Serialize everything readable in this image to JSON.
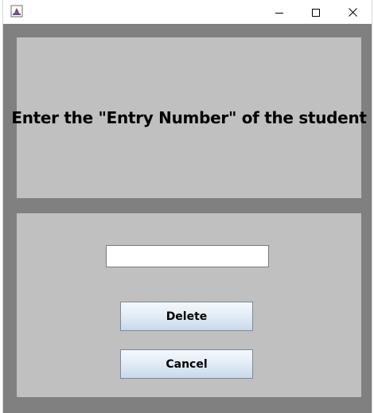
{
  "window": {
    "title": "",
    "controls": {
      "minimize_icon": "minimize-icon",
      "maximize_icon": "maximize-icon",
      "close_icon": "close-icon"
    }
  },
  "dialog": {
    "prompt": "Enter the \"Entry Number\" of the student",
    "entry_input": {
      "value": "",
      "placeholder": ""
    },
    "delete_label": "Delete",
    "cancel_label": "Cancel"
  },
  "colors": {
    "frame_gray": "#808080",
    "panel_gray": "#c0c0c0",
    "button_top": "#f4f8fc",
    "button_bottom": "#c9d9ea"
  }
}
